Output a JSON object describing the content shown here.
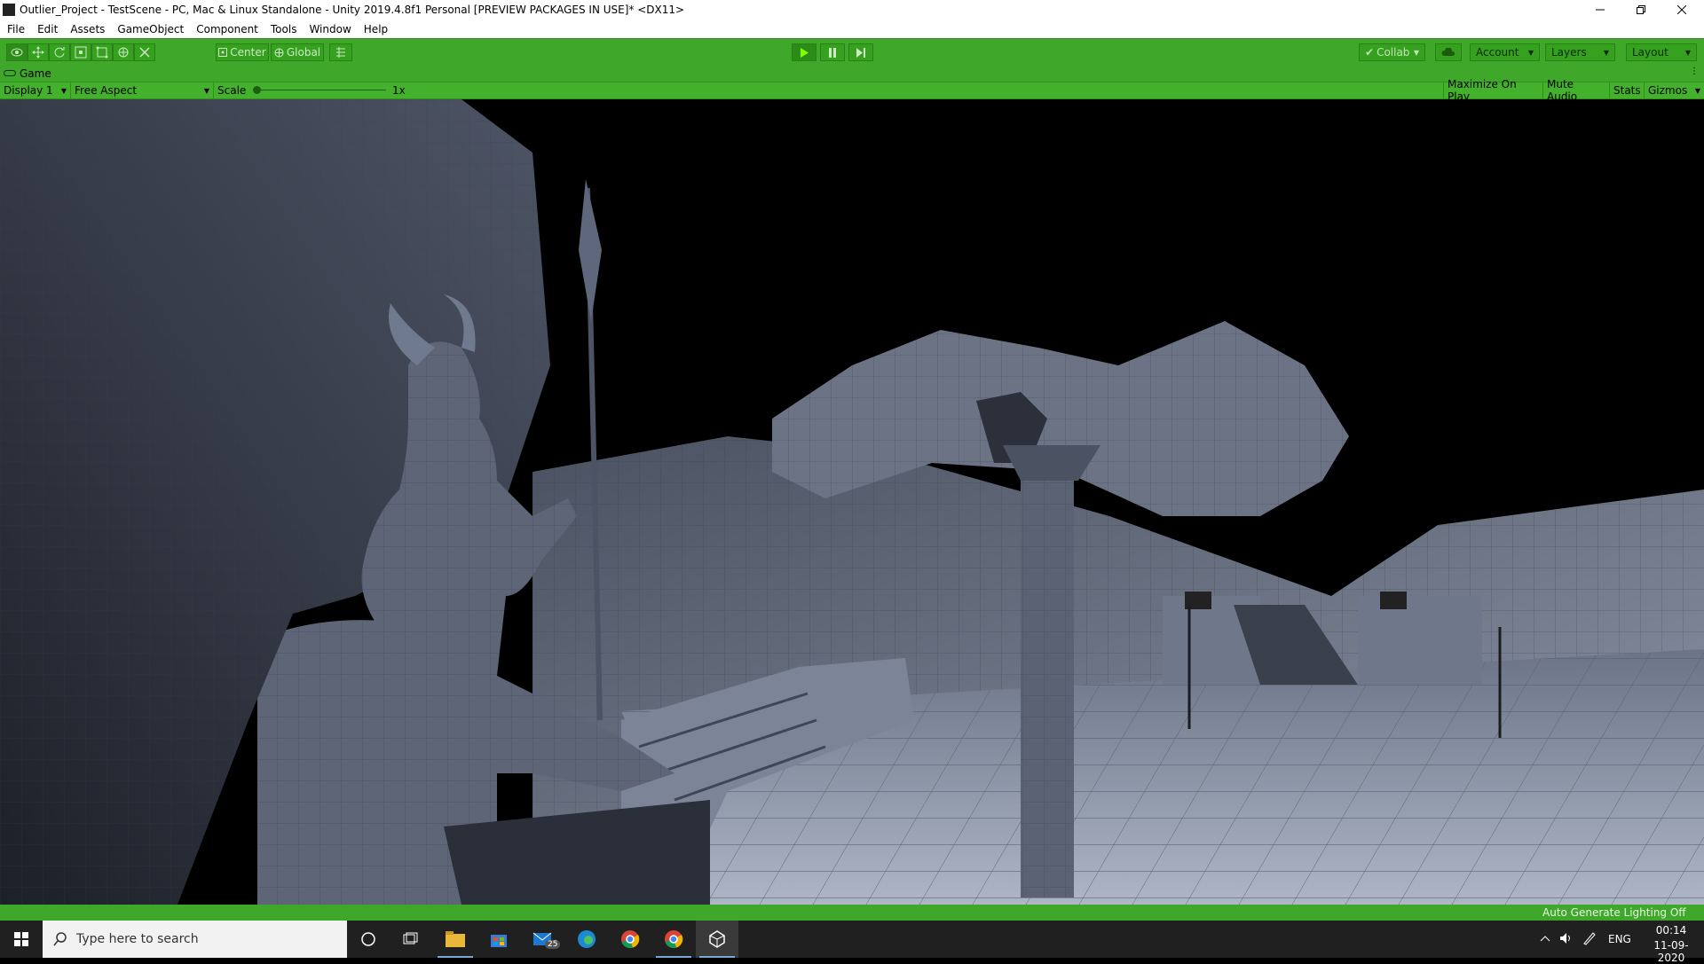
{
  "window": {
    "title": "Outlier_Project - TestScene - PC, Mac & Linux Standalone - Unity 2019.4.8f1 Personal [PREVIEW PACKAGES IN USE]* <DX11>"
  },
  "menu": [
    "File",
    "Edit",
    "Assets",
    "GameObject",
    "Component",
    "Tools",
    "Window",
    "Help"
  ],
  "toolbar": {
    "center_label": "Center",
    "global_label": "Global",
    "collab_label": "Collab",
    "account_label": "Account",
    "layers_label": "Layers",
    "layout_label": "Layout"
  },
  "game_tab": {
    "label": "Game"
  },
  "game_controls": {
    "display": "Display 1",
    "aspect": "Free Aspect",
    "scale_label": "Scale",
    "scale_value": "1x",
    "scale_fraction": 0.0,
    "maximize": "Maximize On Play",
    "mute": "Mute Audio",
    "stats": "Stats",
    "gizmos": "Gizmos"
  },
  "status": {
    "lighting": "Auto Generate Lighting Off"
  },
  "taskbar": {
    "search_placeholder": "Type here to search",
    "mail_badge": "25",
    "lang": "ENG",
    "time": "00:14",
    "date": "11-09-2020"
  },
  "colors": {
    "accent_green": "#3fa82a",
    "play_green": "#7fff00"
  }
}
